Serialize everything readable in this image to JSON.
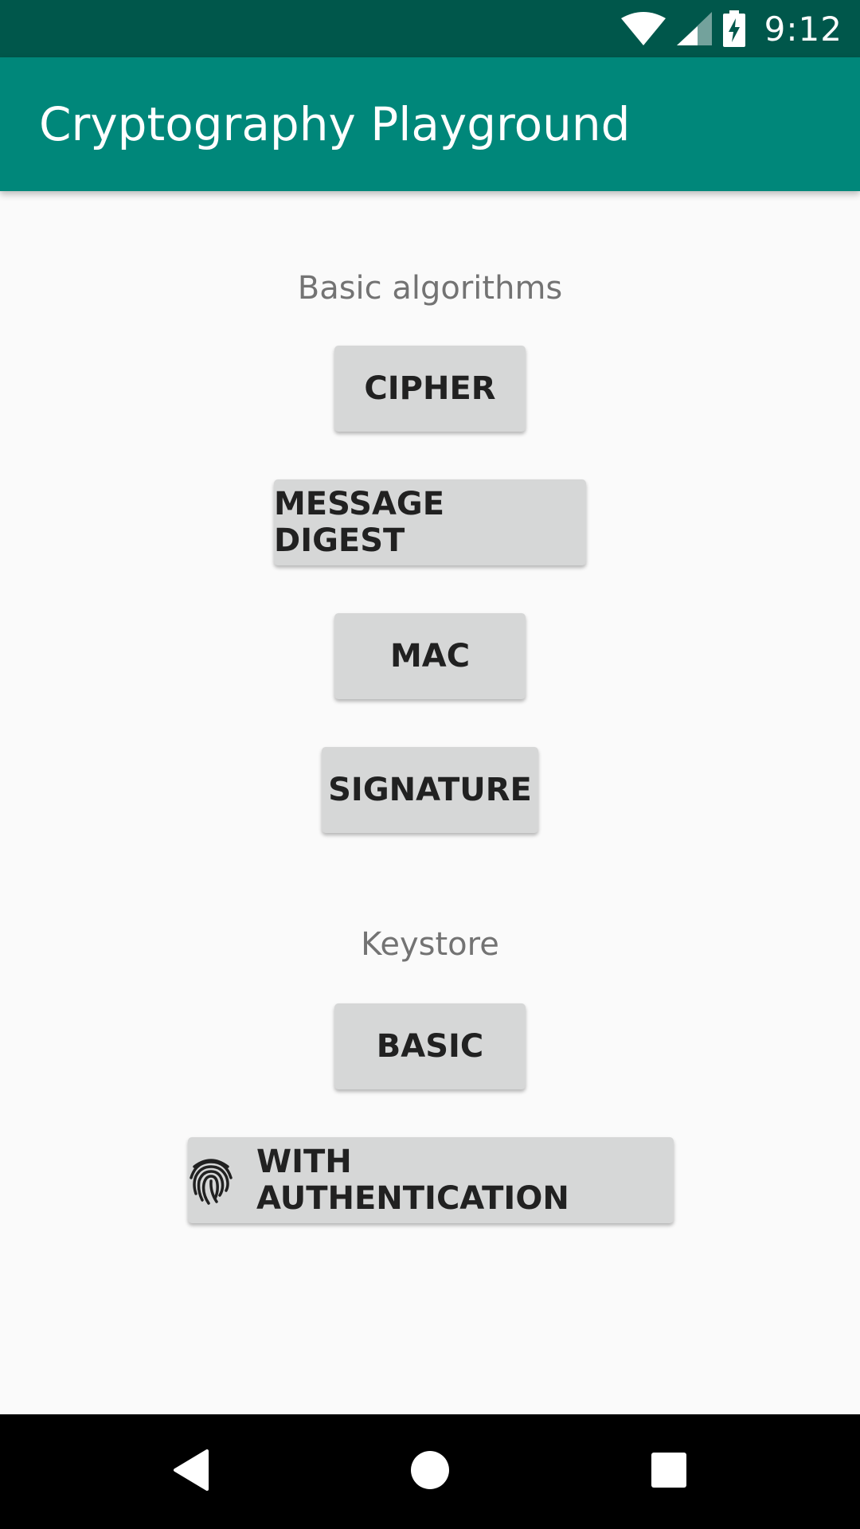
{
  "status_bar": {
    "time": "9:12",
    "icons": [
      "wifi-icon",
      "cell-signal-icon",
      "battery-charging-icon"
    ]
  },
  "app_bar": {
    "title": "Cryptography Playground"
  },
  "sections": {
    "basic": {
      "label": "Basic algorithms",
      "buttons": {
        "cipher": "CIPHER",
        "message_digest": "MESSAGE DIGEST",
        "mac": "MAC",
        "signature": "SIGNATURE"
      }
    },
    "keystore": {
      "label": "Keystore",
      "buttons": {
        "basic": "BASIC",
        "with_authentication": "WITH AUTHENTICATION",
        "with_authentication_icon": "fingerprint-icon"
      }
    }
  },
  "nav_bar": {
    "buttons": [
      "back-icon",
      "home-icon",
      "recents-icon"
    ]
  },
  "colors": {
    "status_bar": "#00574b",
    "app_bar": "#00877a",
    "background": "#fafafa",
    "button": "#d6d7d7",
    "button_text": "#212121",
    "section_label": "#737373"
  }
}
